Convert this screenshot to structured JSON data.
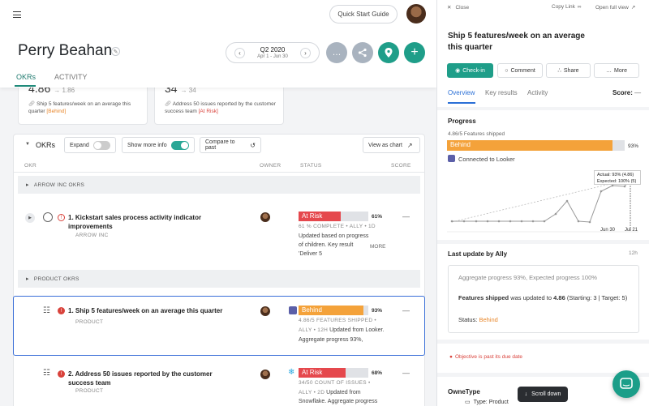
{
  "header": {
    "quick_start": "Quick Start Guide",
    "title": "Perry Beahan",
    "quarter": "Q2 2020",
    "date_range": "Apr 1 - Jun 30",
    "tabs": [
      "OKRs",
      "ACTIVITY"
    ]
  },
  "summary_cards": [
    {
      "value": "4.86",
      "sub": "→ 1.86",
      "desc": "Ship 5 features/week on an average this quarter",
      "status": "[Behind]"
    },
    {
      "value": "34",
      "sub": "→ 34",
      "desc": "Address 50 issues reported by the customer success team",
      "status": "[At Risk]"
    }
  ],
  "toolbar": {
    "okrs_label": "OKRs",
    "expand": "Expand",
    "show_more_info": "Show more info",
    "compare": "Compare to past",
    "view_chart": "View as chart"
  },
  "columns": {
    "okr": "OKR",
    "owner": "OWNER",
    "status": "STATUS",
    "score": "SCORE"
  },
  "groups": [
    "ARROW INC OKRS",
    "PRODUCT OKRS"
  ],
  "okrs": [
    {
      "num": "1.",
      "title": "Kickstart sales process activity indicator improvements",
      "sub": "ARROW INC",
      "status": "At Risk",
      "pct": "61%",
      "progress": 0.61,
      "meta": "61 % COMPLETE • ALLY • 1D",
      "desc": "Updated based on progress of children. Key result 'Deliver 5",
      "more": "MORE",
      "score": "—"
    },
    {
      "num": "1.",
      "title": "Ship 5 features/week on an average this quarter",
      "sub": "PRODUCT",
      "status": "Behind",
      "pct": "93%",
      "progress": 0.93,
      "meta": "4.86/5 FEATURES SHIPPED •",
      "meta2": "ALLY • 12H",
      "meta2_rest": " Updated from Looker.",
      "desc": "Aggregate progress 93%,",
      "score": "—"
    },
    {
      "num": "2.",
      "title": "Address 50 issues reported by the customer success team",
      "sub": "PRODUCT",
      "status": "At Risk",
      "pct": "68%",
      "progress": 0.68,
      "meta": "34/50 COUNT OF ISSUES •",
      "meta2": "ALLY • 2D",
      "meta2_rest": " Updated from",
      "desc": "Snowflake. Aggregate progress",
      "score": "—"
    }
  ],
  "panel": {
    "close": "Close",
    "copy_link": "Copy Link",
    "open_full": "Open full view",
    "title": "Ship 5 features/week on an average this quarter",
    "buttons": {
      "checkin": "Check-in",
      "comment": "Comment",
      "share": "Share",
      "more": "More"
    },
    "tabs": [
      "Overview",
      "Key results",
      "Activity"
    ],
    "score_label": "Score:",
    "score_value": "—",
    "progress_title": "Progress",
    "progress_meta": "4.86/5 Features shipped",
    "progress_status": "Behind",
    "progress_pct": "93%",
    "progress_value": 0.93,
    "connected": "Connected to Looker",
    "tooltip_actual": "Actual: 93% (4.86)",
    "tooltip_expected": "Expected: 100% (5)",
    "x_labels": [
      "Jun 30",
      "Jul 21"
    ],
    "last_update_title": "Last update by Ally",
    "last_update_time": "12h",
    "aggregate": "Aggregate progress 93%, Expected progress 100%",
    "update_bold": "Features shipped",
    "update_mid": " was updated to ",
    "update_val": "4.86",
    "update_tail": " (Starting: 3 | Target: 5)",
    "status_label": "Status: ",
    "status_value": "Behind",
    "past_due": "Objective is past its due date",
    "owner_type": "OwneType",
    "type_product": "Type: Product",
    "scroll_down": "Scroll down"
  },
  "colors": {
    "accent": "#1f9e89",
    "at_risk": "#e5484d",
    "behind": "#f4a23a"
  }
}
